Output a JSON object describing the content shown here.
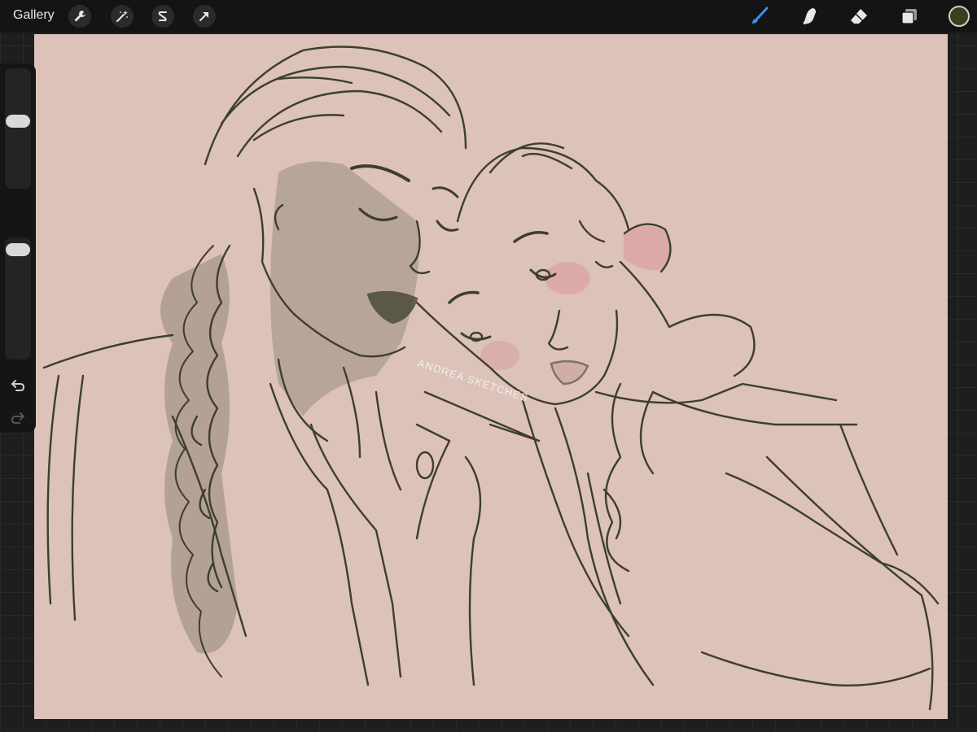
{
  "app": {
    "gallery_label": "Gallery",
    "left_tools": [
      {
        "name": "actions",
        "icon": "wrench-icon"
      },
      {
        "name": "adjustments",
        "icon": "magic-wand-icon"
      },
      {
        "name": "selection",
        "icon": "selection-s-icon"
      },
      {
        "name": "transform",
        "icon": "arrow-cursor-icon"
      }
    ],
    "right_tools": [
      {
        "name": "brush",
        "icon": "brush-icon",
        "active": true
      },
      {
        "name": "smudge",
        "icon": "smudge-finger-icon",
        "active": false
      },
      {
        "name": "eraser",
        "icon": "eraser-icon",
        "active": false
      },
      {
        "name": "layers",
        "icon": "layers-icon",
        "active": false
      }
    ],
    "current_color": "#3a3f1c",
    "accent_color": "#3a8ef6"
  },
  "sidebar": {
    "brush_size_level": 0.57,
    "opacity_level": 0.95,
    "modify_icon": "square-modify-icon",
    "undo_icon": "undo-arrow-icon",
    "redo_icon": "redo-arrow-icon",
    "redo_enabled": false
  },
  "canvas": {
    "background_color": "#dcc2b9",
    "line_color": "#3c3f2c",
    "blush_color": "#d9a5a5",
    "signature_color": "#f2eee8",
    "signature_text": "ANDREA SKETCHES"
  }
}
